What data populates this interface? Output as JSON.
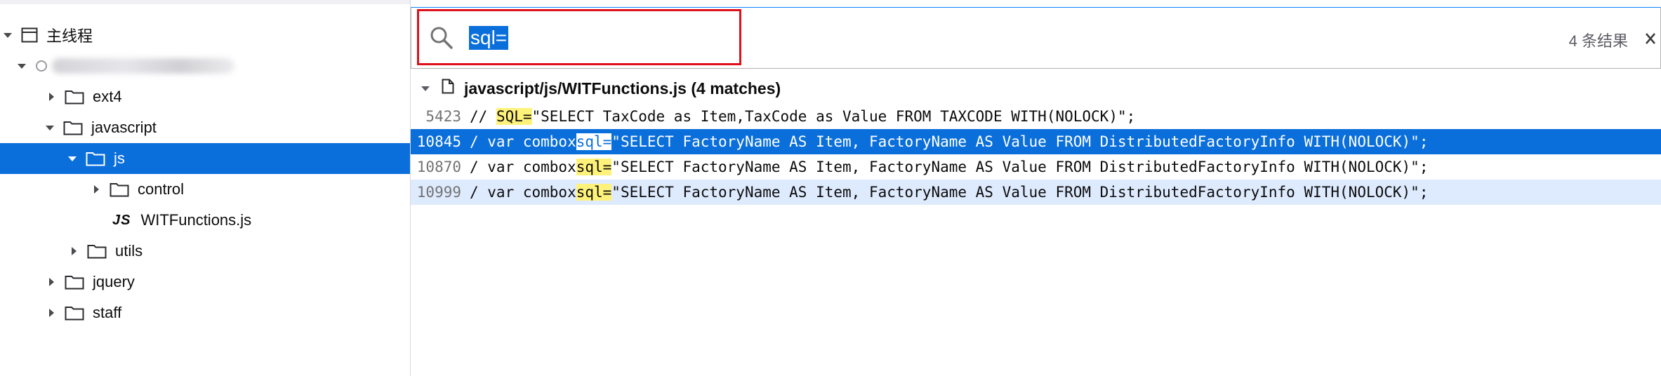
{
  "tree": {
    "root": {
      "label": "主线程"
    },
    "items": [
      {
        "label": "ext4"
      },
      {
        "label": "javascript"
      },
      {
        "label": "js"
      },
      {
        "label": "control"
      },
      {
        "label": "WITFunctions.js",
        "badge": "JS"
      },
      {
        "label": "utils"
      },
      {
        "label": "jquery"
      },
      {
        "label": "staff"
      }
    ]
  },
  "search": {
    "query": "sql=",
    "result_count": "4 条结果"
  },
  "results": {
    "file_header": "javascript/js/WITFunctions.js (4 matches)",
    "rows": [
      {
        "line": "5423",
        "prefix": "// ",
        "match": "SQL=",
        "suffix": "\"SELECT TaxCode as Item,TaxCode as Value FROM TAXCODE WITH(NOLOCK)\";"
      },
      {
        "line": "10845",
        "prefix": "/ var combox",
        "match": "sql=",
        "suffix": "\"SELECT FactoryName AS Item, FactoryName AS Value FROM DistributedFactoryInfo WITH(NOLOCK)\";"
      },
      {
        "line": "10870",
        "prefix": "/ var combox",
        "match": "sql=",
        "suffix": "\"SELECT FactoryName AS Item, FactoryName AS Value FROM DistributedFactoryInfo WITH(NOLOCK)\";"
      },
      {
        "line": "10999",
        "prefix": "/ var combox",
        "match": "sql=",
        "suffix": "\"SELECT FactoryName AS Item, FactoryName AS Value FROM DistributedFactoryInfo WITH(NOLOCK)\";"
      }
    ]
  },
  "colors": {
    "selection": "#0a6fdb",
    "match_highlight": "#fff27a",
    "focus_box": "#e0101a"
  },
  "icons": [
    "chevron-down-icon",
    "chevron-right-icon",
    "window-icon",
    "globe-icon",
    "folder-icon",
    "file-icon",
    "search-icon",
    "close-icon"
  ]
}
